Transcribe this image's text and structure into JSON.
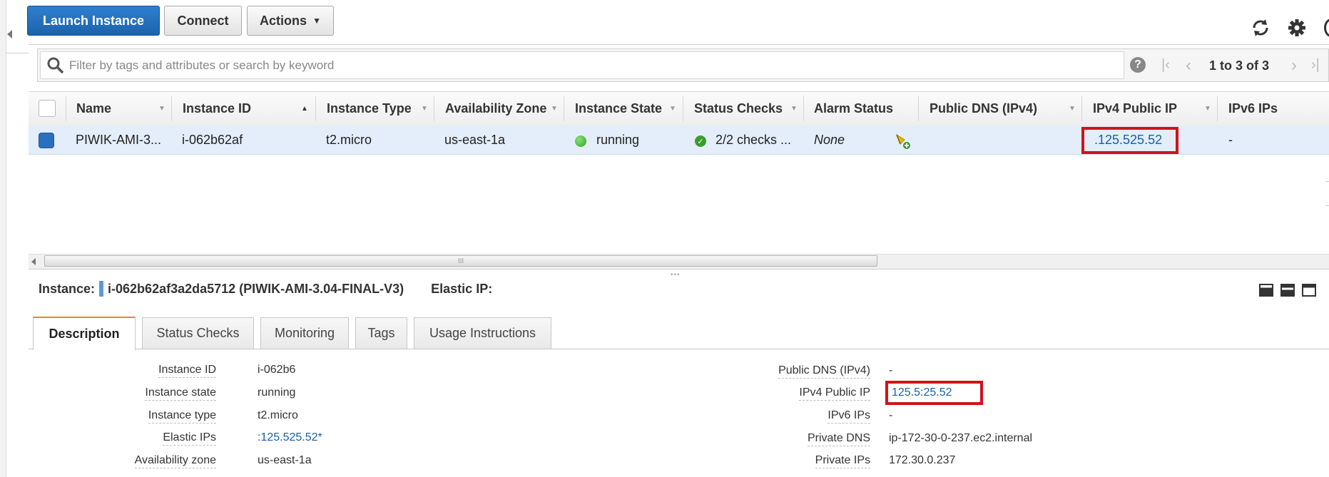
{
  "toolbar": {
    "launch_label": "Launch Instance",
    "connect_label": "Connect",
    "actions_label": "Actions"
  },
  "search": {
    "placeholder": "Filter by tags and attributes or search by keyword"
  },
  "pagination": {
    "range": "1 to 3 of 3"
  },
  "table": {
    "headers": {
      "name": "Name",
      "instance_id": "Instance ID",
      "instance_type": "Instance Type",
      "availability_zone": "Availability Zone",
      "instance_state": "Instance State",
      "status_checks": "Status Checks",
      "alarm_status": "Alarm Status",
      "public_dns": "Public DNS (IPv4)",
      "ipv4_public_ip": "IPv4 Public IP",
      "ipv6_ips": "IPv6 IPs"
    },
    "row": {
      "name": "PIWIK-AMI-3...",
      "instance_id": "i-062b62af",
      "instance_type": "t2.micro",
      "availability_zone": "us-east-1a",
      "instance_state": "running",
      "status_checks": "2/2 checks ...",
      "alarm_status": "None",
      "ipv4_public_ip": ".125.525.52",
      "ipv6_ips": "-"
    },
    "scroll_marker": "III"
  },
  "details": {
    "instance_label": "Instance:",
    "instance_title": "i-062b62af3a2da5712 (PIWIK-AMI-3.04-FINAL-V3)",
    "elastic_label": "Elastic IP:",
    "tabs": [
      "Description",
      "Status Checks",
      "Monitoring",
      "Tags",
      "Usage Instructions"
    ],
    "left": [
      {
        "label": "Instance ID",
        "value": "i-062b6"
      },
      {
        "label": "Instance state",
        "value": "running"
      },
      {
        "label": "Instance type",
        "value": "t2.micro"
      },
      {
        "label": "Elastic IPs",
        "value": ":125.525.52*"
      },
      {
        "label": "Availability zone",
        "value": "us-east-1a"
      }
    ],
    "right": [
      {
        "label": "Public DNS (IPv4)",
        "value": "-"
      },
      {
        "label": "IPv4 Public IP",
        "value": "125.5:25.52"
      },
      {
        "label": "IPv6 IPs",
        "value": "-"
      },
      {
        "label": "Private DNS",
        "value": "ip-172-30-0-237.ec2.internal"
      },
      {
        "label": "Private IPs",
        "value": "172.30.0.237"
      }
    ]
  },
  "colors": {
    "primary": "#1f6bb8",
    "running": "#2fa51f",
    "highlight": "#d0131b",
    "link": "#1a5fa8"
  }
}
